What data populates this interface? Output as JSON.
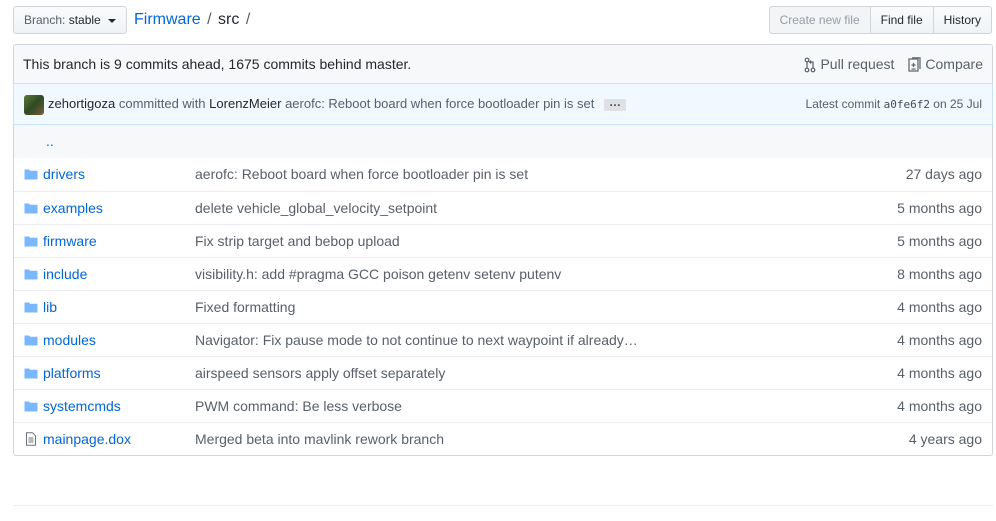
{
  "topbar": {
    "branch_prefix": "Branch:",
    "branch_name": "stable",
    "breadcrumb_repo": "Firmware",
    "breadcrumb_sep1": "/",
    "breadcrumb_dir": "src",
    "breadcrumb_sep2": "/",
    "buttons": {
      "create_new_file": "Create new file",
      "find_file": "Find file",
      "history": "History"
    }
  },
  "branch_info": {
    "message": "This branch is 9 commits ahead, 1675 commits behind master.",
    "pull_request": "Pull request",
    "compare": "Compare"
  },
  "commit": {
    "author": "zehortigoza",
    "committed_with": "committed with",
    "committer": "LorenzMeier",
    "message": "aerofc: Reboot board when force bootloader pin is set",
    "ellipsis": "…",
    "latest_commit_label": "Latest commit",
    "sha": "a0fe6f2",
    "date": "on 25 Jul"
  },
  "files": {
    "up_label": "..",
    "rows": [
      {
        "name": "drivers",
        "type": "dir",
        "message": "aerofc: Reboot board when force bootloader pin is set",
        "age": "27 days ago"
      },
      {
        "name": "examples",
        "type": "dir",
        "message": "delete vehicle_global_velocity_setpoint",
        "age": "5 months ago"
      },
      {
        "name": "firmware",
        "type": "dir",
        "message": "Fix strip target and bebop upload",
        "age": "5 months ago"
      },
      {
        "name": "include",
        "type": "dir",
        "message": "visibility.h: add #pragma GCC poison getenv setenv putenv",
        "age": "8 months ago"
      },
      {
        "name": "lib",
        "type": "dir",
        "message": "Fixed formatting",
        "age": "4 months ago"
      },
      {
        "name": "modules",
        "type": "dir",
        "message": "Navigator: Fix pause mode to not continue to next waypoint if already…",
        "age": "4 months ago"
      },
      {
        "name": "platforms",
        "type": "dir",
        "message": "airspeed sensors apply offset separately",
        "age": "4 months ago"
      },
      {
        "name": "systemcmds",
        "type": "dir",
        "message": "PWM command: Be less verbose",
        "age": "4 months ago"
      },
      {
        "name": "mainpage.dox",
        "type": "file",
        "message": "Merged beta into mavlink rework branch",
        "age": "4 years ago"
      }
    ]
  },
  "colors": {
    "link": "#0366d6",
    "muted": "#586069",
    "folder_icon": "#79b8ff",
    "commit_bg": "#f1f8ff"
  }
}
